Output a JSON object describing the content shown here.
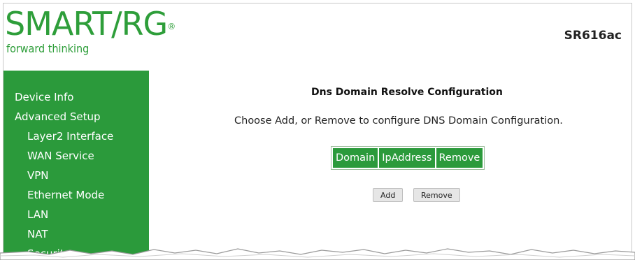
{
  "header": {
    "logo_text": "SMART/RG",
    "logo_mark": "®",
    "tagline": "forward thinking",
    "model": "SR616ac"
  },
  "sidebar": {
    "items": [
      {
        "label": "Device Info"
      },
      {
        "label": "Advanced Setup"
      },
      {
        "label": "Layer2 Interface"
      },
      {
        "label": "WAN Service"
      },
      {
        "label": "VPN"
      },
      {
        "label": "Ethernet Mode"
      },
      {
        "label": "LAN"
      },
      {
        "label": "NAT"
      },
      {
        "label": "Security"
      }
    ]
  },
  "main": {
    "title": "Dns Domain Resolve Configuration",
    "instructions": "Choose Add, or Remove to configure DNS Domain Configuration.",
    "table": {
      "headers": [
        "Domain",
        "IpAddress",
        "Remove"
      ]
    },
    "buttons": {
      "add": "Add",
      "remove": "Remove"
    }
  },
  "colors": {
    "brand_green": "#2b9a3b",
    "button_gray": "#e6e6e6"
  }
}
